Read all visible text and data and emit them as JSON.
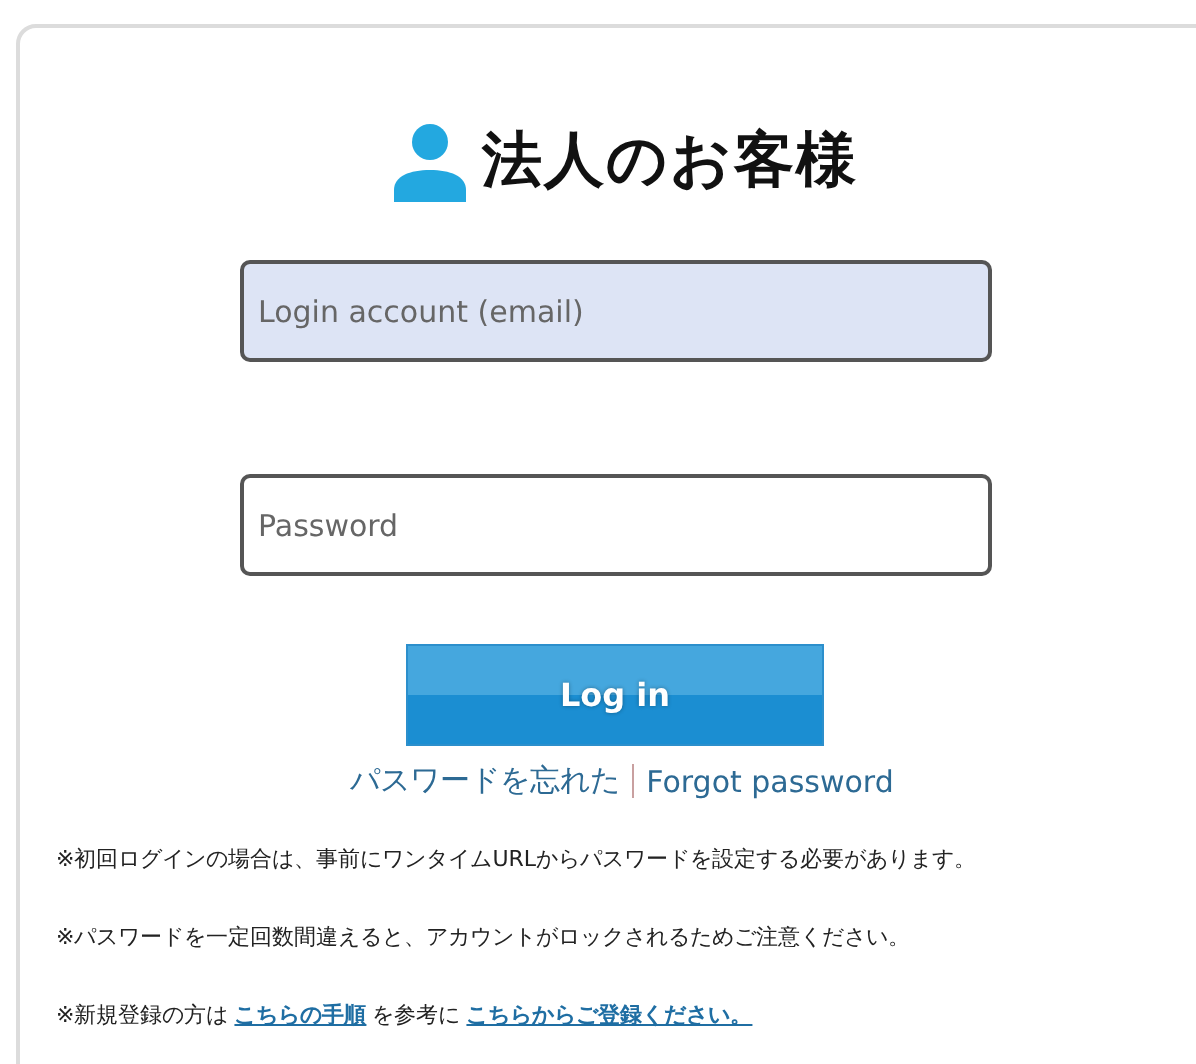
{
  "title": "法人のお客様",
  "fields": [
    {
      "placeholder": "Login account (email)",
      "focused": true
    },
    {
      "placeholder": "Password",
      "focused": false
    }
  ],
  "login_button": "Log in",
  "links": [
    {
      "kind": "link",
      "text": "パスワードを忘れた"
    },
    {
      "kind": "link",
      "text": "Forgot password"
    }
  ],
  "notes": [
    [
      {
        "kind": "text",
        "text": "※初回ログインの場合は、事前にワンタイムURLからパスワードを設定する必要があります。"
      }
    ],
    [
      {
        "kind": "text",
        "text": "※パスワードを一定回数間違えると、アカウントがロックされるためご注意ください。"
      }
    ],
    [
      {
        "kind": "text",
        "text": "※新規登録の方は"
      },
      {
        "kind": "link",
        "text": "こちらの手順"
      },
      {
        "kind": "text",
        "text": "を参考に"
      },
      {
        "kind": "link",
        "text": "こちらからご登録ください。"
      }
    ]
  ]
}
